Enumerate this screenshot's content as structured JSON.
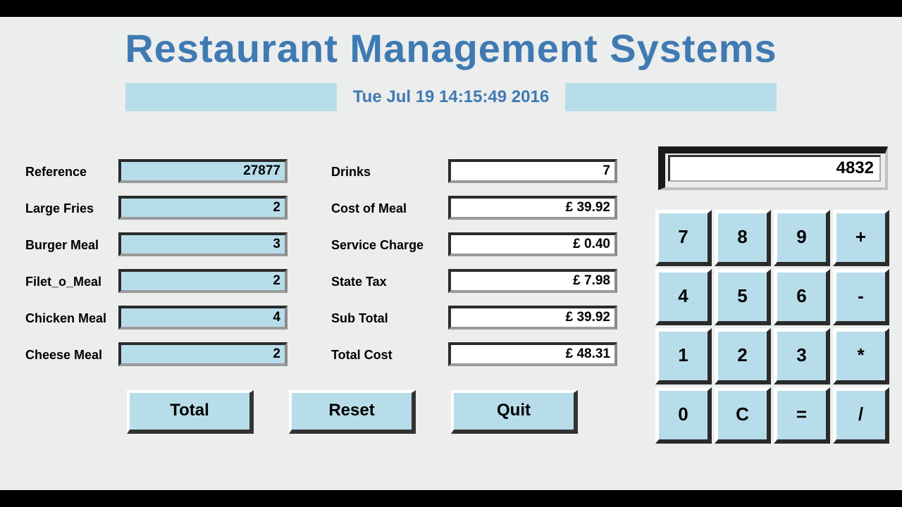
{
  "title": "Restaurant Management Systems",
  "date": "Tue Jul 19 14:15:49 2016",
  "left": {
    "reference": {
      "label": "Reference",
      "value": "27877"
    },
    "large_fries": {
      "label": "Large Fries",
      "value": "2"
    },
    "burger_meal": {
      "label": "Burger Meal",
      "value": "3"
    },
    "filet_o_meal": {
      "label": "Filet_o_Meal",
      "value": "2"
    },
    "chicken_meal": {
      "label": "Chicken Meal",
      "value": "4"
    },
    "cheese_meal": {
      "label": "Cheese Meal",
      "value": "2"
    }
  },
  "right": {
    "drinks": {
      "label": "Drinks",
      "value": "7"
    },
    "cost_of_meal": {
      "label": "Cost of Meal",
      "value": "£ 39.92"
    },
    "service_charge": {
      "label": "Service Charge",
      "value": "£ 0.40"
    },
    "state_tax": {
      "label": "State Tax",
      "value": "£ 7.98"
    },
    "sub_total": {
      "label": "Sub Total",
      "value": "£ 39.92"
    },
    "total_cost": {
      "label": "Total Cost",
      "value": "£ 48.31"
    }
  },
  "buttons": {
    "total": "Total",
    "reset": "Reset",
    "quit": "Quit"
  },
  "calculator": {
    "display": "4832",
    "keys": [
      "7",
      "8",
      "9",
      "+",
      "4",
      "5",
      "6",
      "-",
      "1",
      "2",
      "3",
      "*",
      "0",
      "C",
      "=",
      "/"
    ]
  }
}
